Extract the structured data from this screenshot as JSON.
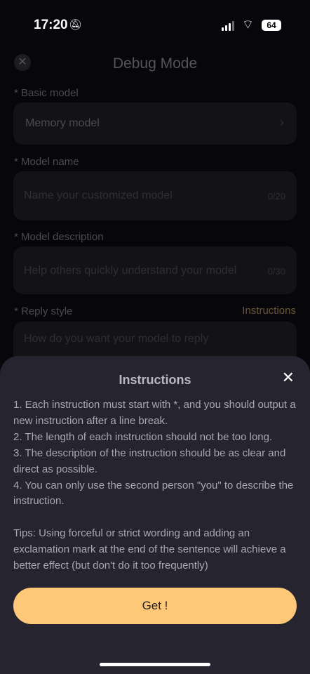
{
  "status_bar": {
    "time": "17:20",
    "battery": "64"
  },
  "header": {
    "title": "Debug Mode"
  },
  "form": {
    "basic_model": {
      "label": "* Basic model",
      "value": "Memory model"
    },
    "model_name": {
      "label": "* Model name",
      "placeholder": "Name your customized model",
      "count": "0/20"
    },
    "model_description": {
      "label": "* Model description",
      "placeholder": "Help others quickly understand your model",
      "count": "0/30"
    },
    "reply_style": {
      "label": "* Reply style",
      "link": "Instructions",
      "placeholder": "How do you want your model to reply"
    }
  },
  "sheet": {
    "title": "Instructions",
    "items": [
      "1. Each instruction must start with *, and you should output a new instruction after a line break.",
      "2. The length of each instruction should not be too long.",
      "3. The description of the instruction should be as clear and direct as possible.",
      "4. You can only use the second person \"you\" to describe the instruction."
    ],
    "tips": "Tips: Using forceful or strict wording and adding an exclamation mark at the end of the sentence will achieve a better effect (but don't do it too frequently)",
    "button": "Get !"
  }
}
